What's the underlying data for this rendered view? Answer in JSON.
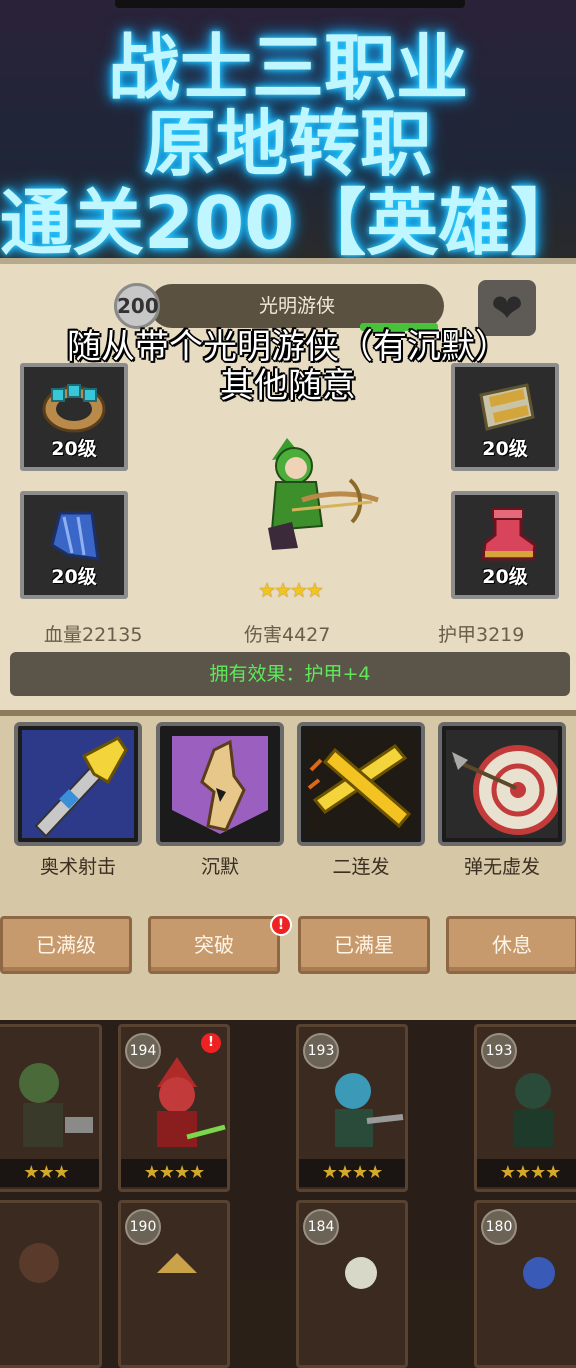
{
  "banner": {
    "line1": "战士三职业",
    "line2": "原地转职",
    "line3": "通关200【英雄】"
  },
  "hero": {
    "level": "200",
    "name": "光明游侠",
    "stars": "★★★★",
    "overlay_line1": "随从带个光明游侠（有沉默）",
    "overlay_line2": "其他随意",
    "stats": {
      "hp": "血量22135",
      "attack": "伤害4427",
      "armor": "护甲3219"
    },
    "effect": "拥有效果：护甲+4"
  },
  "equipment": [
    {
      "slot": "ring",
      "level": "20级"
    },
    {
      "slot": "bracer",
      "level": "20级"
    },
    {
      "slot": "cape",
      "level": "20级"
    },
    {
      "slot": "boots",
      "level": "20级"
    }
  ],
  "skills": [
    {
      "name": "奥术射击",
      "icon": "arcane-arrow-icon"
    },
    {
      "name": "沉默",
      "icon": "silence-icon"
    },
    {
      "name": "二连发",
      "icon": "double-shot-icon"
    },
    {
      "name": "弹无虚发",
      "icon": "bullseye-icon"
    }
  ],
  "actions": {
    "max_level": "已满级",
    "breakthrough": "突破",
    "max_star": "已满星",
    "rest": "休息",
    "alert": "!"
  },
  "roster": [
    {
      "level": "",
      "stars": "★★★"
    },
    {
      "level": "194",
      "stars": "★★★★",
      "alert": "!"
    },
    {
      "level": "193",
      "stars": "★★★★"
    },
    {
      "level": "193",
      "stars": "★★★★"
    },
    {
      "level": ""
    },
    {
      "level": "190"
    },
    {
      "level": "184"
    },
    {
      "level": "180"
    }
  ],
  "colors": {
    "glow": "#2fd3ff",
    "effect_green": "#5ee85a",
    "star_gold": "#f3c322",
    "parchment": "#e7dbc2"
  }
}
